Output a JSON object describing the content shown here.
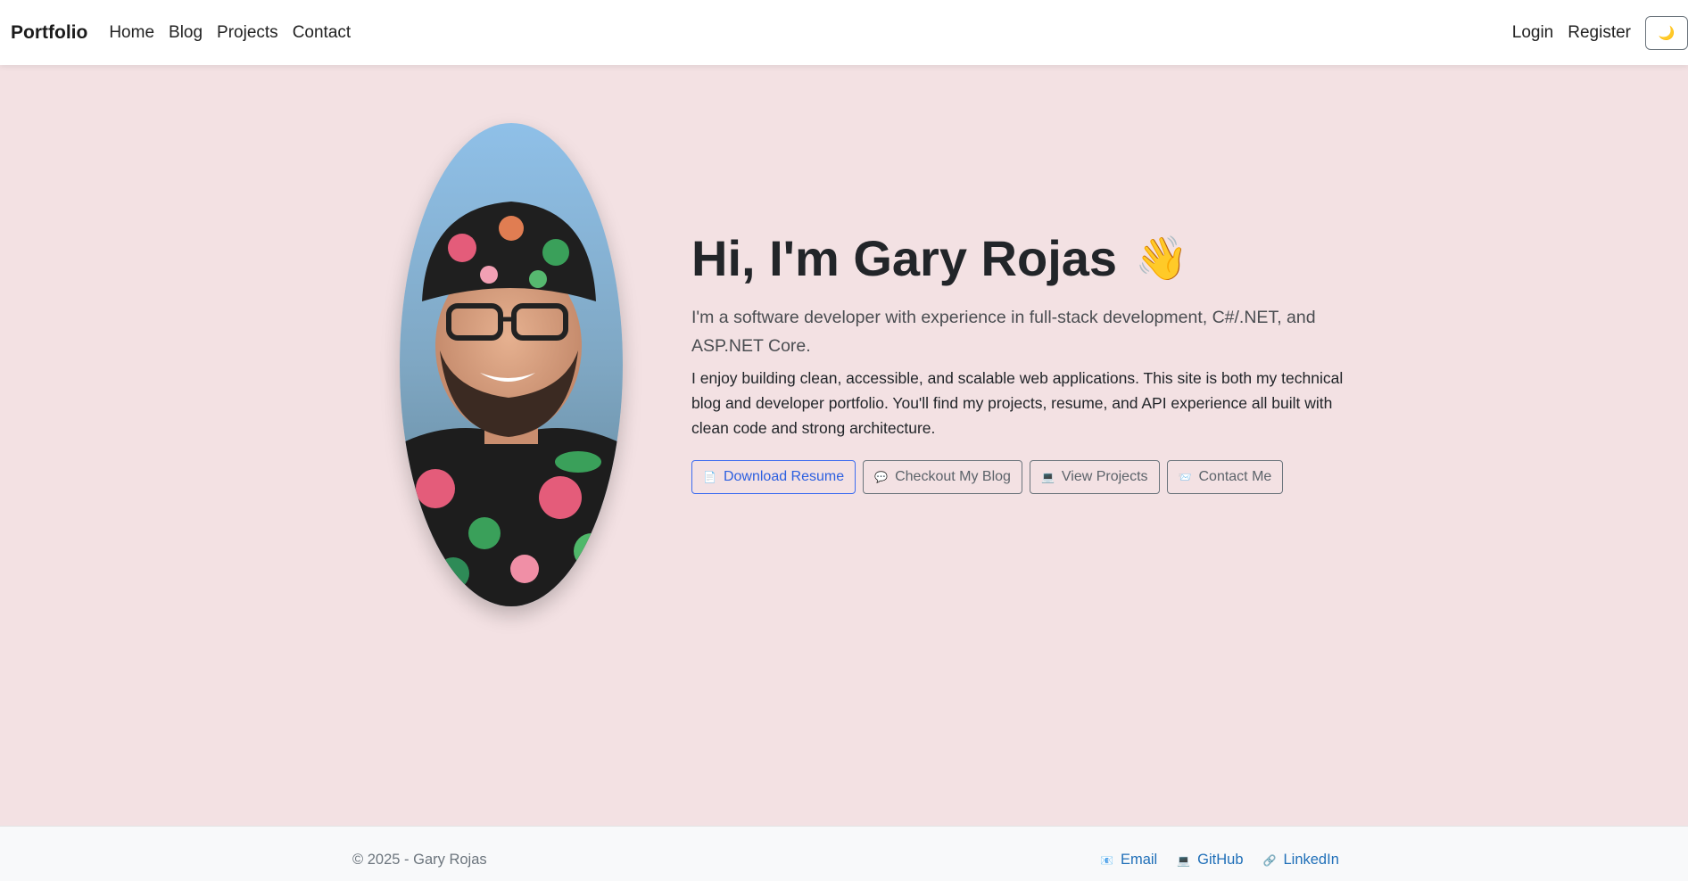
{
  "navbar": {
    "brand": "Portfolio",
    "links": [
      "Home",
      "Blog",
      "Projects",
      "Contact"
    ],
    "auth": {
      "login": "Login",
      "register": "Register"
    },
    "theme_toggle_icon": "🌙"
  },
  "hero": {
    "title": "Hi, I'm Gary Rojas",
    "wave": "👋",
    "lead": "I'm a software developer with experience in full-stack development, C#/.NET, and ASP.NET Core.",
    "description": "I enjoy building clean, accessible, and scalable web applications. This site is both my technical blog and developer portfolio. You'll find my projects, resume, and API experience all built with clean code and strong architecture.",
    "buttons": [
      {
        "icon": "📄",
        "label": "Download Resume"
      },
      {
        "icon": "💬",
        "label": "Checkout My Blog"
      },
      {
        "icon": "💻",
        "label": "View Projects"
      },
      {
        "icon": "📨",
        "label": "Contact Me"
      }
    ]
  },
  "footer": {
    "copyright": "© 2025 - Gary Rojas",
    "links": [
      {
        "icon": "📧",
        "label": "Email"
      },
      {
        "icon": "💻",
        "label": "GitHub"
      },
      {
        "icon": "🔗",
        "label": "LinkedIn"
      }
    ]
  },
  "colors": {
    "page_background": "#f3e1e3",
    "primary": "#3d6cf0",
    "footer_link": "#1f6fb8"
  }
}
